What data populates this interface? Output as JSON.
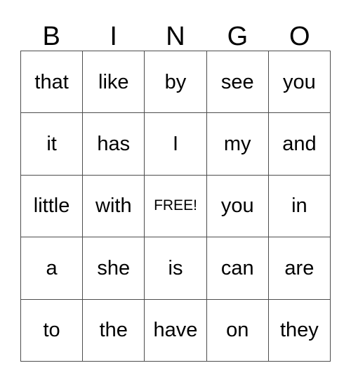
{
  "card": {
    "title": "BINGO",
    "header_letters": [
      "B",
      "I",
      "N",
      "G",
      "O"
    ],
    "free_space_label": "FREE!",
    "free_space_position": {
      "row": 2,
      "col": 2
    },
    "grid_size": "5x5",
    "colors": {
      "background": "#ffffff",
      "text": "#000000",
      "border": "#4d4d4d"
    },
    "rows": [
      {
        "cells": [
          {
            "text": "that",
            "free": false
          },
          {
            "text": "like",
            "free": false
          },
          {
            "text": "by",
            "free": false
          },
          {
            "text": "see",
            "free": false
          },
          {
            "text": "you",
            "free": false
          }
        ]
      },
      {
        "cells": [
          {
            "text": "it",
            "free": false
          },
          {
            "text": "has",
            "free": false
          },
          {
            "text": "I",
            "free": false
          },
          {
            "text": "my",
            "free": false
          },
          {
            "text": "and",
            "free": false
          }
        ]
      },
      {
        "cells": [
          {
            "text": "little",
            "free": false
          },
          {
            "text": "with",
            "free": false
          },
          {
            "text": "FREE!",
            "free": true
          },
          {
            "text": "you",
            "free": false
          },
          {
            "text": "in",
            "free": false
          }
        ]
      },
      {
        "cells": [
          {
            "text": "a",
            "free": false
          },
          {
            "text": "she",
            "free": false
          },
          {
            "text": "is",
            "free": false
          },
          {
            "text": "can",
            "free": false
          },
          {
            "text": "are",
            "free": false
          }
        ]
      },
      {
        "cells": [
          {
            "text": "to",
            "free": false
          },
          {
            "text": "the",
            "free": false
          },
          {
            "text": "have",
            "free": false
          },
          {
            "text": "on",
            "free": false
          },
          {
            "text": "they",
            "free": false
          }
        ]
      }
    ]
  }
}
